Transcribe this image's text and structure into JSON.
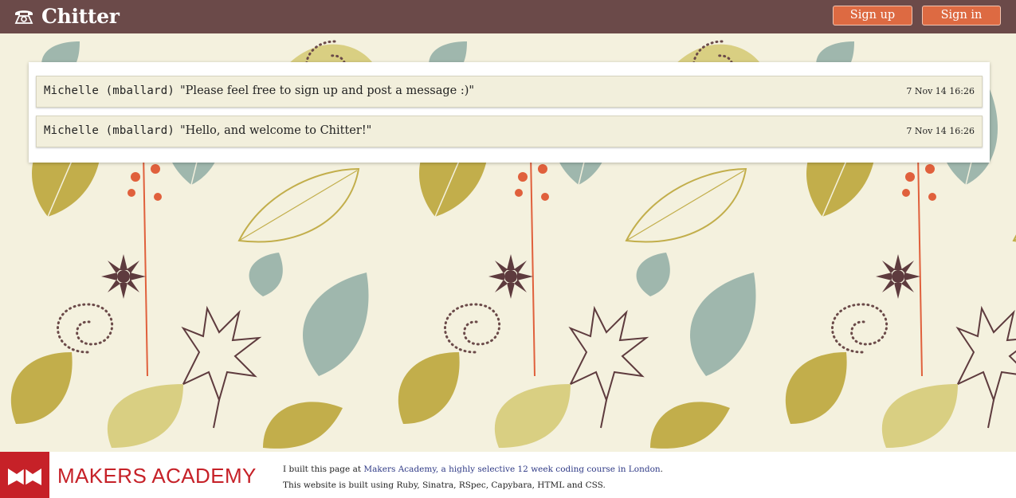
{
  "header": {
    "app_name": "Chitter",
    "logo_icon": "telephone-icon",
    "signup_label": "Sign up",
    "signin_label": "Sign in"
  },
  "messages": [
    {
      "author": "Michelle (mballard)",
      "text": "\"Please feel free to sign up and post a message :)\"",
      "time": "7 Nov 14 16:26"
    },
    {
      "author": "Michelle (mballard)",
      "text": "\"Hello, and welcome to Chitter!\"",
      "time": "7 Nov 14 16:26"
    }
  ],
  "footer": {
    "brand_name": "MAKERS ACADEMY",
    "brand_icon": "makers-book-icon",
    "line1_prefix": "I built this page at ",
    "line1_link": "Makers Academy, a highly selective 12 week coding course in London",
    "line1_suffix": ".",
    "line2": "This website is built using Ruby, Sinatra, RSpec, Capybara, HTML and CSS."
  },
  "colors": {
    "header_bg": "#6b4a49",
    "button_bg": "#dd6a42",
    "pattern_bg": "#f4f1de",
    "message_bg": "#f2efdc",
    "brand_red": "#c62128",
    "link": "#2f3a86"
  }
}
